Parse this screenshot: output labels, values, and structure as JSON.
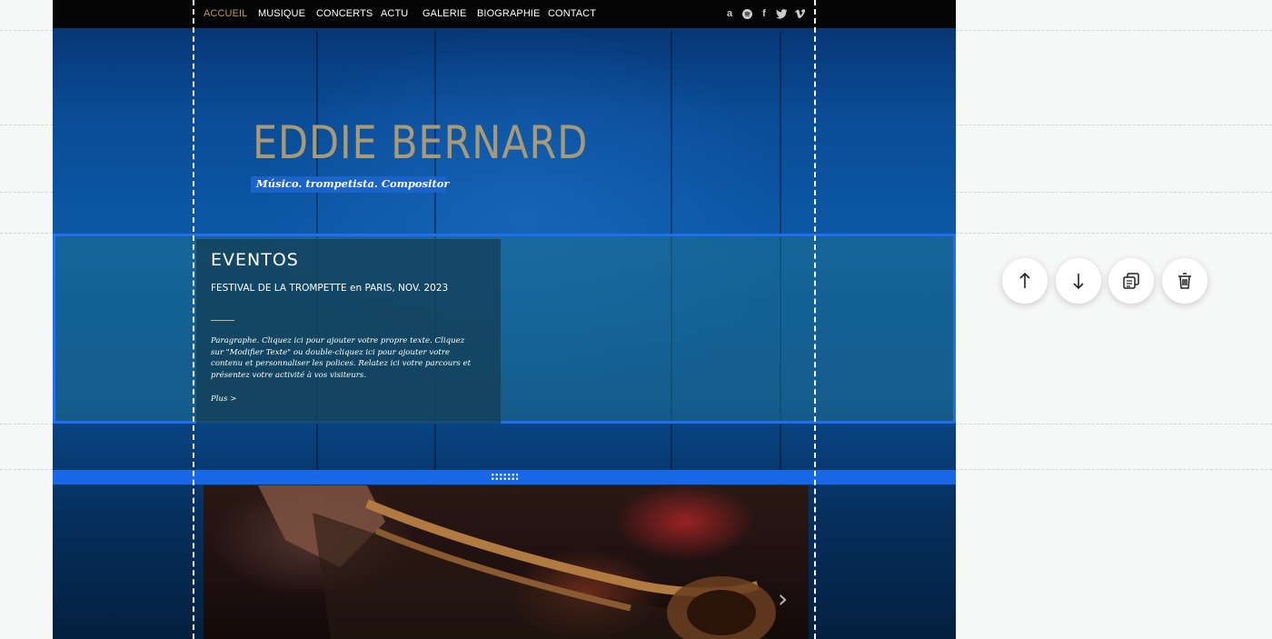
{
  "nav": {
    "items": [
      "ACCUEIL",
      "MUSIQUE",
      "CONCERTS",
      "ACTU",
      "GALERIE",
      "BIOGRAPHIE",
      "CONTACT"
    ],
    "active": "ACCUEIL",
    "social_icons": [
      "amazon-icon",
      "spotify-icon",
      "facebook-icon",
      "twitter-icon",
      "vimeo-icon"
    ]
  },
  "hero": {
    "title": "EDDIE BERNARD",
    "subtitle": "Músico. trompetista. Compositor"
  },
  "events": {
    "title": "EVENTOS",
    "subtitle": "FESTIVAL DE LA TROMPETTE en PARIS, NOV. 2023",
    "paragraph": "Paragraphe. Cliquez ici pour ajouter votre propre texte. Cliquez sur \"Modifier Texte\" ou double-cliquez ici pour ajouter votre contenu et personnaliser les polices. Relatez ici votre parcours et présentez votre activité à vos visiteurs.",
    "more": "Plus >"
  },
  "toolbar": {
    "buttons": [
      "move-up-icon",
      "move-down-icon",
      "duplicate-icon",
      "delete-icon"
    ]
  },
  "colors": {
    "accent": "#1f6ff0",
    "nav_active": "#b49a6d",
    "title": "#a89a76",
    "subtitle_bg": "#1b63c9"
  }
}
